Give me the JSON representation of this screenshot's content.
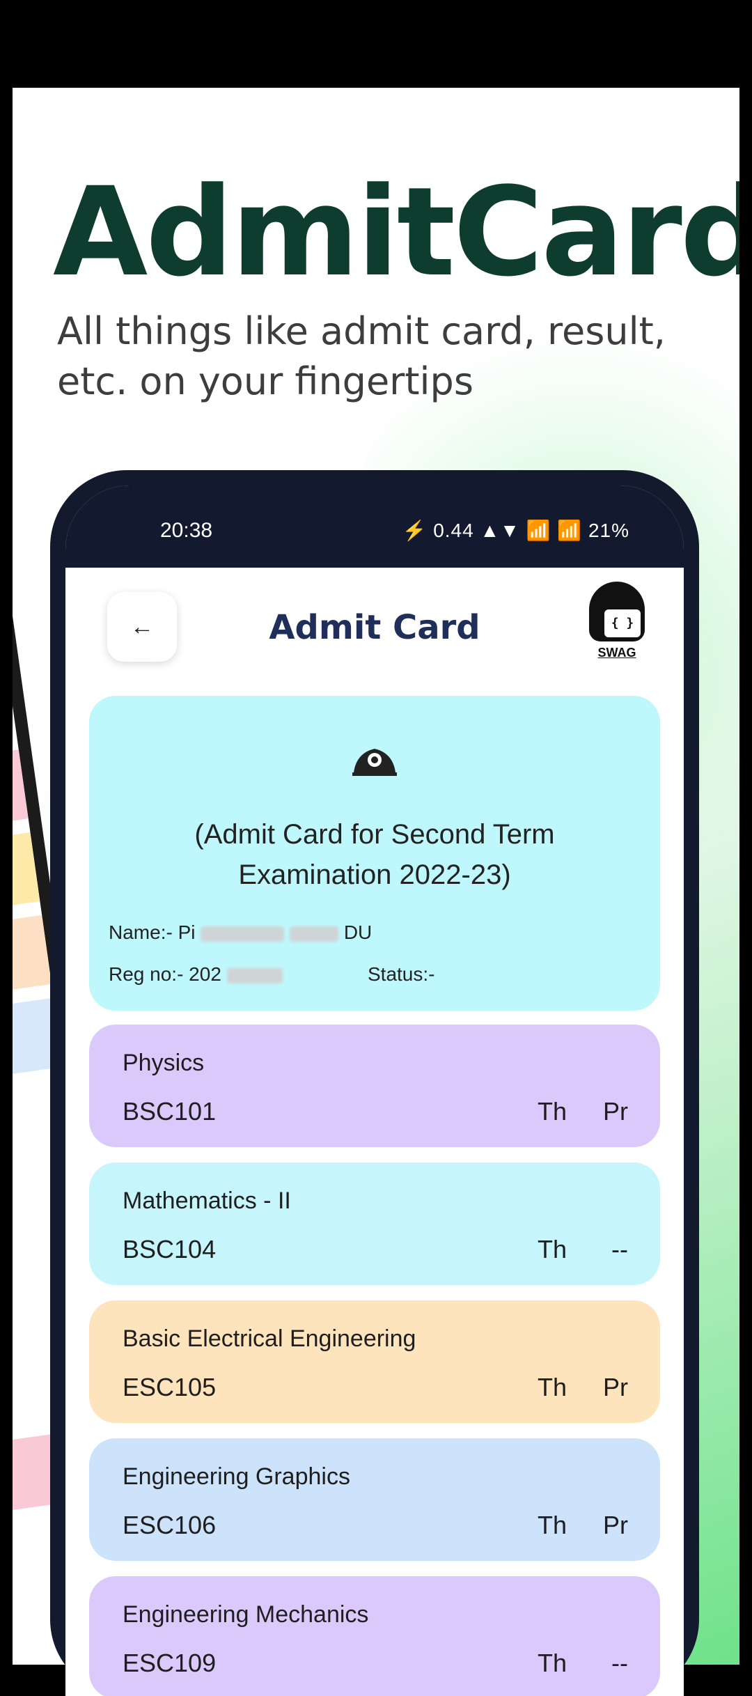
{
  "promo": {
    "title": "AdmitCard",
    "subtitle": "All things like admit card, result, etc. on your fingertips"
  },
  "status_bar": {
    "time": "20:38",
    "indicators": "⚡ 0.44 ▲▼ 📶 📶 21%"
  },
  "app_bar": {
    "back_icon": "←",
    "title": "Admit Card",
    "brand_icon_text": "{ }",
    "brand_label": "SWAG"
  },
  "admit_info": {
    "heading": "(Admit Card for Second Term Examination 2022-23)",
    "name_label": "Name:- Pi",
    "name_tail": "DU",
    "reg_label": "Reg no:- 202",
    "status_label": "Status:-"
  },
  "subjects": [
    {
      "name": "Physics",
      "code": "BSC101",
      "th": "Th",
      "pr": "Pr",
      "color": "#dcc9fb"
    },
    {
      "name": "Mathematics - II",
      "code": "BSC104",
      "th": "Th",
      "pr": "--",
      "color": "#c6f5fb"
    },
    {
      "name": "Basic Electrical Engineering",
      "code": "ESC105",
      "th": "Th",
      "pr": "Pr",
      "color": "#fde4bd"
    },
    {
      "name": "Engineering Graphics",
      "code": "ESC106",
      "th": "Th",
      "pr": "Pr",
      "color": "#cde2fb"
    },
    {
      "name": "Engineering Mechanics",
      "code": "ESC109",
      "th": "Th",
      "pr": "--",
      "color": "#dcc9fb"
    }
  ]
}
